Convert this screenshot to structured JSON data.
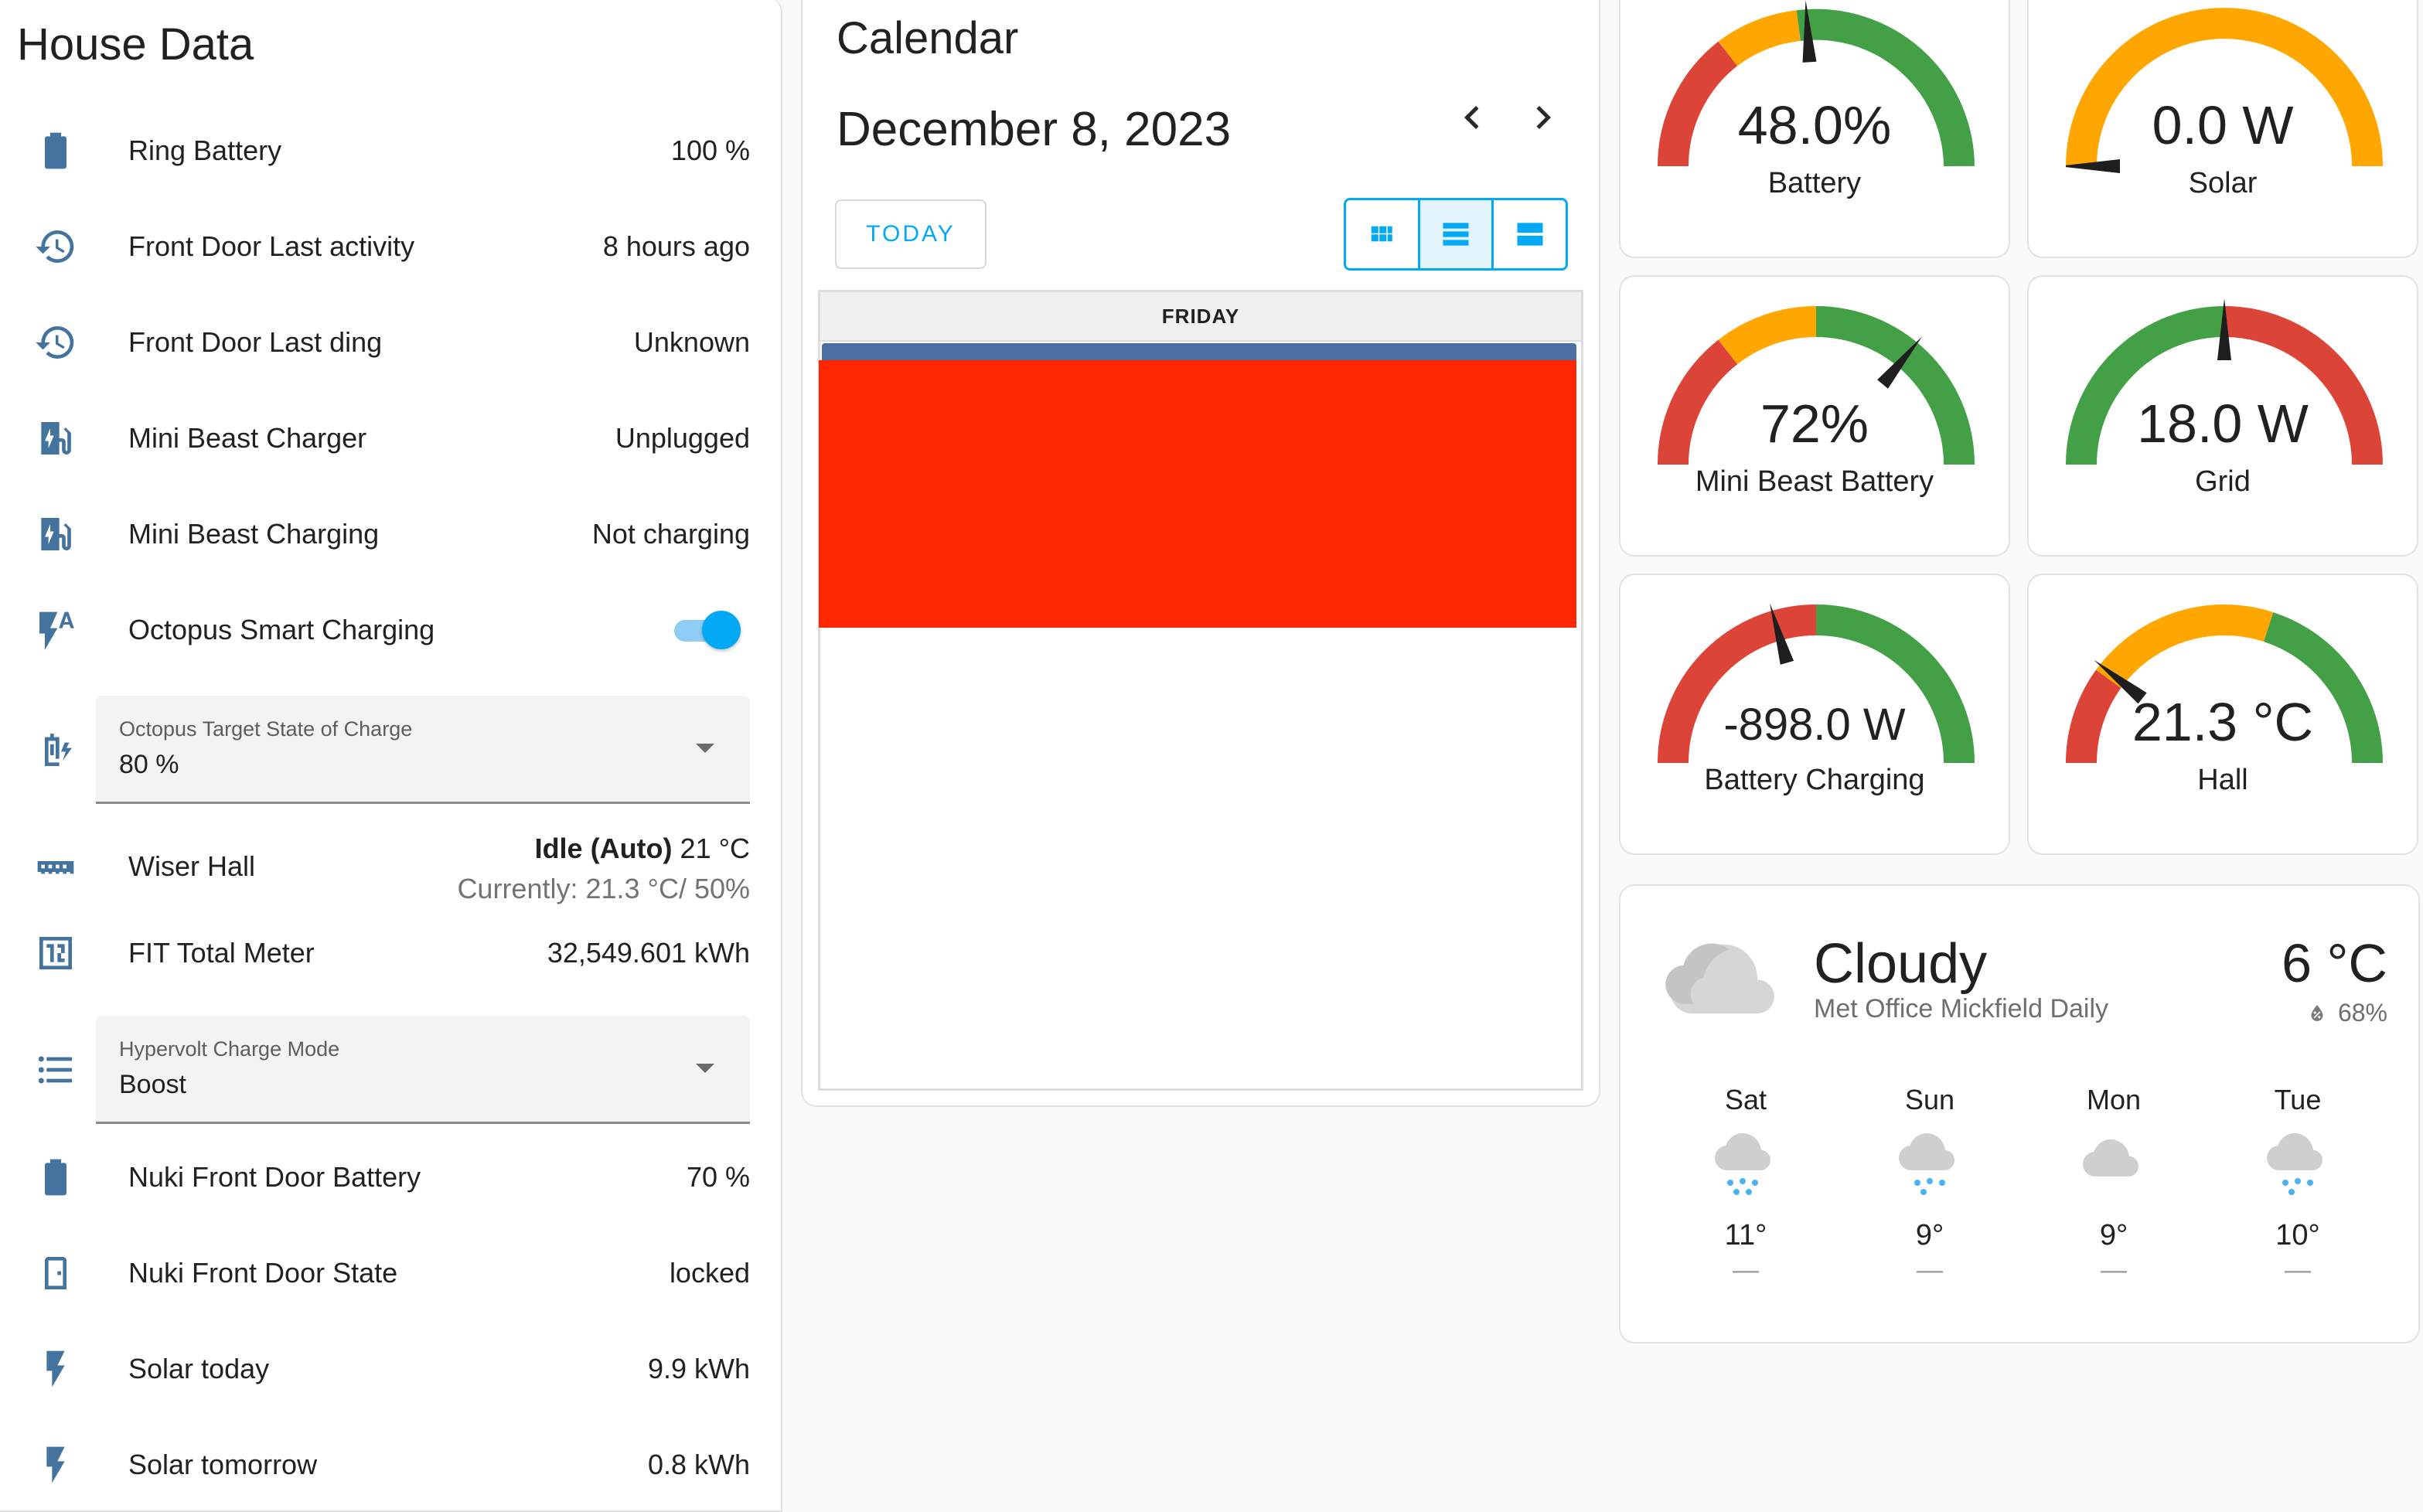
{
  "house": {
    "title": "House Data",
    "rows": [
      {
        "label": "Ring Battery",
        "value": "100 %",
        "icon": "battery-icon"
      },
      {
        "label": "Front Door Last activity",
        "value": "8 hours ago",
        "icon": "history-icon"
      },
      {
        "label": "Front Door Last ding",
        "value": "Unknown",
        "icon": "history-icon"
      },
      {
        "label": "Mini Beast Charger",
        "value": "Unplugged",
        "icon": "ev-station-icon"
      },
      {
        "label": "Mini Beast Charging",
        "value": "Not charging",
        "icon": "ev-station-icon"
      },
      {
        "label": "Octopus Smart Charging",
        "value": "on",
        "icon": "flash-auto-icon"
      }
    ],
    "target_select": {
      "label": "Octopus Target State of Charge",
      "value": "80 %",
      "icon": "battery-charging-icon"
    },
    "wiser": {
      "label": "Wiser Hall",
      "state": "Idle (Auto)",
      "target": "21 °C",
      "current": "Currently: 21.3 °C/ 50%",
      "icon": "radiator-icon"
    },
    "fit": {
      "label": "FIT Total Meter",
      "value": "32,549.601 kWh",
      "icon": "meter-icon"
    },
    "hypervolt_select": {
      "label": "Hypervolt Charge Mode",
      "value": "Boost",
      "icon": "list-icon"
    },
    "rows2": [
      {
        "label": "Nuki Front Door Battery",
        "value": "70 %",
        "icon": "battery-icon"
      },
      {
        "label": "Nuki Front Door State",
        "value": "locked",
        "icon": "door-icon"
      },
      {
        "label": "Solar today",
        "value": "9.9 kWh",
        "icon": "flash-icon"
      },
      {
        "label": "Solar tomorrow",
        "value": "0.8 kWh",
        "icon": "flash-icon"
      }
    ]
  },
  "calendar": {
    "title": "Calendar",
    "date": "December 8, 2023",
    "today_label": "TODAY",
    "day_header": "FRIDAY",
    "views": [
      "month-view-icon",
      "week-list-icon",
      "day-view-icon"
    ],
    "active_view": 1
  },
  "gauges": [
    {
      "name": "Battery",
      "value_text": "48.0%",
      "value": 48.0,
      "min": 0,
      "max": 100
    },
    {
      "name": "Solar",
      "value_text": "0.0 W",
      "value": 0.0,
      "min": 0,
      "max": 100
    },
    {
      "name": "Mini Beast Battery",
      "value_text": "72%",
      "value": 72,
      "min": 0,
      "max": 100
    },
    {
      "name": "Grid",
      "value_text": "18.0 W",
      "value": 18.0,
      "min": 0,
      "max": 36
    },
    {
      "name": "Battery Charging",
      "value_text": "-898.0 W",
      "value": -898.0,
      "min": -5000,
      "max": 5000
    },
    {
      "name": "Hall",
      "value_text": "21.3 °C",
      "value": 21.3,
      "min": 0,
      "max": 100
    }
  ],
  "weather": {
    "state": "Cloudy",
    "source": "Met Office Mickfield Daily",
    "temperature": "6 °C",
    "humidity": "68%",
    "forecast": [
      {
        "day": "Sat",
        "temp": "11°",
        "low": "—",
        "icon": "rainy-icon"
      },
      {
        "day": "Sun",
        "temp": "9°",
        "low": "—",
        "icon": "rainy-icon"
      },
      {
        "day": "Mon",
        "temp": "9°",
        "low": "—",
        "icon": "cloudy-icon"
      },
      {
        "day": "Tue",
        "temp": "10°",
        "low": "—",
        "icon": "rainy-icon"
      }
    ]
  },
  "colors": {
    "accent": "#03a9f4",
    "icon": "#44739e",
    "red": "#db4437",
    "orange": "#ffa600",
    "green": "#43a047",
    "redaction": "#ff2600"
  }
}
